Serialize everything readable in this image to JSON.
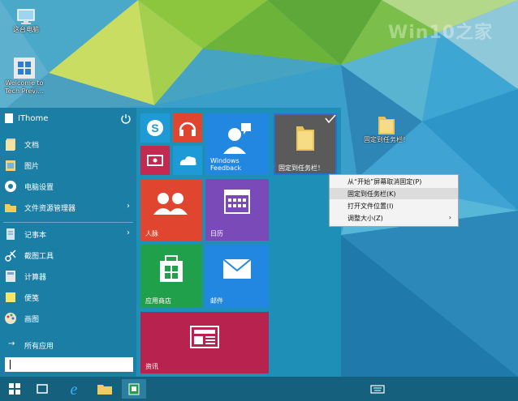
{
  "desktop": {
    "watermark": "Win10之家",
    "icons": [
      {
        "label": "这台电脑"
      },
      {
        "label": "Welcome to Tech Previ..."
      },
      {
        "label": "固定到任务栏！"
      }
    ]
  },
  "start_menu": {
    "user_name": "IThome",
    "items": [
      {
        "label": "文档",
        "has_arrow": false
      },
      {
        "label": "图片",
        "has_arrow": false
      },
      {
        "label": "电脑设置",
        "has_arrow": false
      },
      {
        "label": "文件资源管理器",
        "has_arrow": true
      },
      {
        "label": "记事本",
        "has_arrow": true
      },
      {
        "label": "截图工具",
        "has_arrow": false
      },
      {
        "label": "计算器",
        "has_arrow": false
      },
      {
        "label": "便笺",
        "has_arrow": false
      },
      {
        "label": "画图",
        "has_arrow": false
      }
    ],
    "all_apps": "所有应用",
    "tiles": {
      "windows_feedback": "Windows Feedback",
      "pinned_folder": "固定到任务栏！",
      "people": "人脉",
      "calendar": "日历",
      "store": "应用商店",
      "mail": "邮件",
      "news": "资讯"
    }
  },
  "context_menu": {
    "items": [
      {
        "label": "从“开始”屏幕取消固定(P)"
      },
      {
        "label": "固定到任务栏(K)"
      },
      {
        "label": "打开文件位置(I)"
      },
      {
        "label": "调整大小(Z)"
      }
    ],
    "submenu_arrow": "›"
  },
  "colors": {
    "tile_blue": "#1e9bd7",
    "tile_red": "#c4294f",
    "tile_orange": "#e0462f",
    "tile_purple": "#7a4ab8",
    "tile_green": "#20a04a",
    "tile_sky": "#2287e0",
    "tile_crimson": "#b8224e",
    "tile_grey": "#5a5a5a"
  }
}
